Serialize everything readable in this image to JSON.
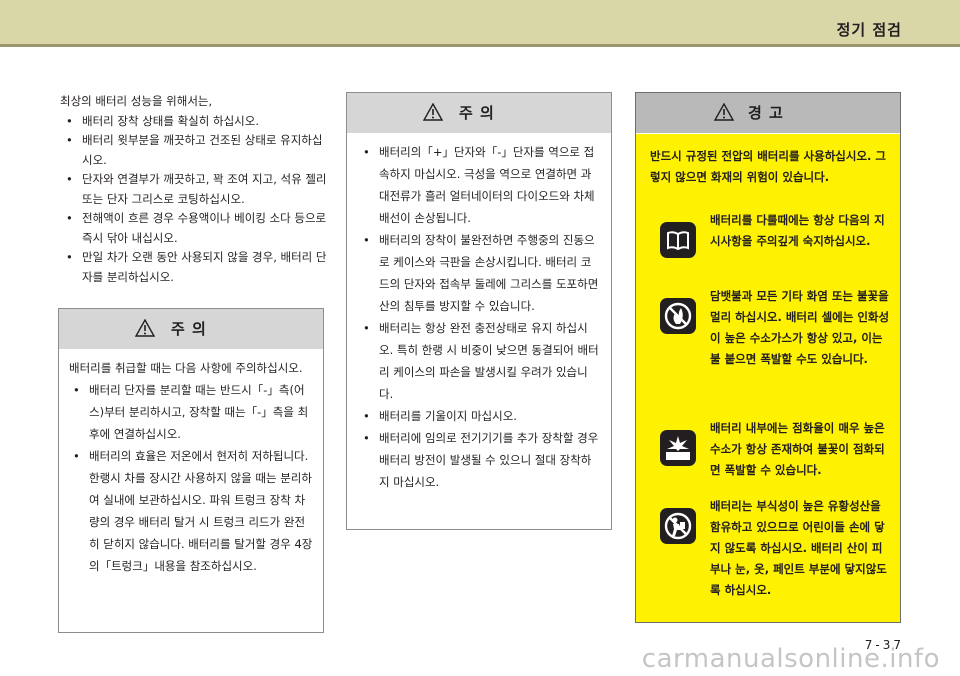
{
  "header": {
    "section_title": "정기 점검"
  },
  "intro": {
    "lead": "최상의 배터리 성능을 위해서는,",
    "items": [
      "배터리 장착 상태를 확실히 하십시오.",
      "배터리 윗부분을 깨끗하고 건조된 상태로 유지하십시오.",
      "단자와 연결부가 깨끗하고, 꽉 조여 지고, 석유 젤리 또는 단자 그리스로 코팅하십시오.",
      "전해액이 흐른 경우 수용액이나 베이킹 소다 등으로 즉시 닦아 내십시오.",
      "만일 차가 오랜 동안 사용되지 않을 경우, 배터리 단자를 분리하십시오."
    ]
  },
  "caution1": {
    "title": "주  의",
    "lead": "배터리를 취급할 때는 다음 사항에 주의하십시오.",
    "items": [
      "배터리 단자를 분리할 때는 반드시「-」측(어스)부터 분리하시고, 장착할 때는「-」측을 최후에 연결하십시오.",
      "배터리의 효율은 저온에서 현저히 저하됩니다. 한랭시 차를 장시간 사용하지 않을 때는 분리하여 실내에 보관하십시오. 파워 트렁크 장착 차량의 경우 배터리 탈거 시 트렁크 리드가 완전히 닫히지 않습니다. 배터리를 탈거할 경우 4장의「트렁크」내용을 참조하십시오."
    ]
  },
  "caution2": {
    "title": "주  의",
    "items": [
      "배터리의「+」단자와「-」단자를 역으로 접속하지 마십시오. 극성을 역으로 연결하면 과대전류가 흘러 얼터네이터의 다이오드와 차체 배선이 손상됩니다.",
      "배터리의 장착이 불완전하면 주행중의 진동으로 케이스와 극판을 손상시킵니다. 배터리 코드의 단자와 접속부 둘레에 그리스를 도포하면 산의 침투를 방지할 수 있습니다.",
      "배터리는 항상 완전 충전상태로 유지 하십시오. 특히 한랭 시 비중이 낮으면 동결되어 배터리 케이스의 파손을 발생시킬 우려가 있습니다.",
      "배터리를 기울이지 마십시오.",
      "배터리에 임의로 전기기기를 추가 장착할 경우 배터리 방전이 발생될 수 있으니 절대 장착하지 마십시오."
    ]
  },
  "warning": {
    "title": "경  고",
    "lead": "반드시 규정된 전압의 배터리를 사용하십시오. 그렇지 않으면 화재의 위험이 있습니다.",
    "items": [
      {
        "icon": "manual-book-icon",
        "text": "배터리를 다룰때에는 항상 다음의 지시사항을 주의깊게 숙지하십시오."
      },
      {
        "icon": "no-flame-icon",
        "text": "담뱃불과 모든 기타 화염 또는 불꽃을 멀리 하십시오. 배터리 셀에는 인화성이 높은 수소가스가 항상 있고, 이는 불 붙으면 폭발할 수도 있습니다."
      },
      {
        "icon": "explosion-icon",
        "text": "배터리 내부에는 점화율이 매우 높은 수소가 항상 존재하여 불꽃이 점화되면 폭발할 수 있습니다."
      },
      {
        "icon": "keep-away-children-icon",
        "text": "배터리는 부식성이 높은 유황성산을 함유하고 있으므로 어린이들 손에 닿지 않도록 하십시오. 배터리 산이 피부나 눈, 옷, 페인트 부분에 닿지않도록 하십시오."
      }
    ]
  },
  "footer": {
    "page_number": "7-37",
    "watermark": "carmanualsonline.info"
  },
  "colors": {
    "header_band": "#d9d6a8",
    "warning_panel": "#fff200",
    "box_head": "#d6d6d6"
  }
}
